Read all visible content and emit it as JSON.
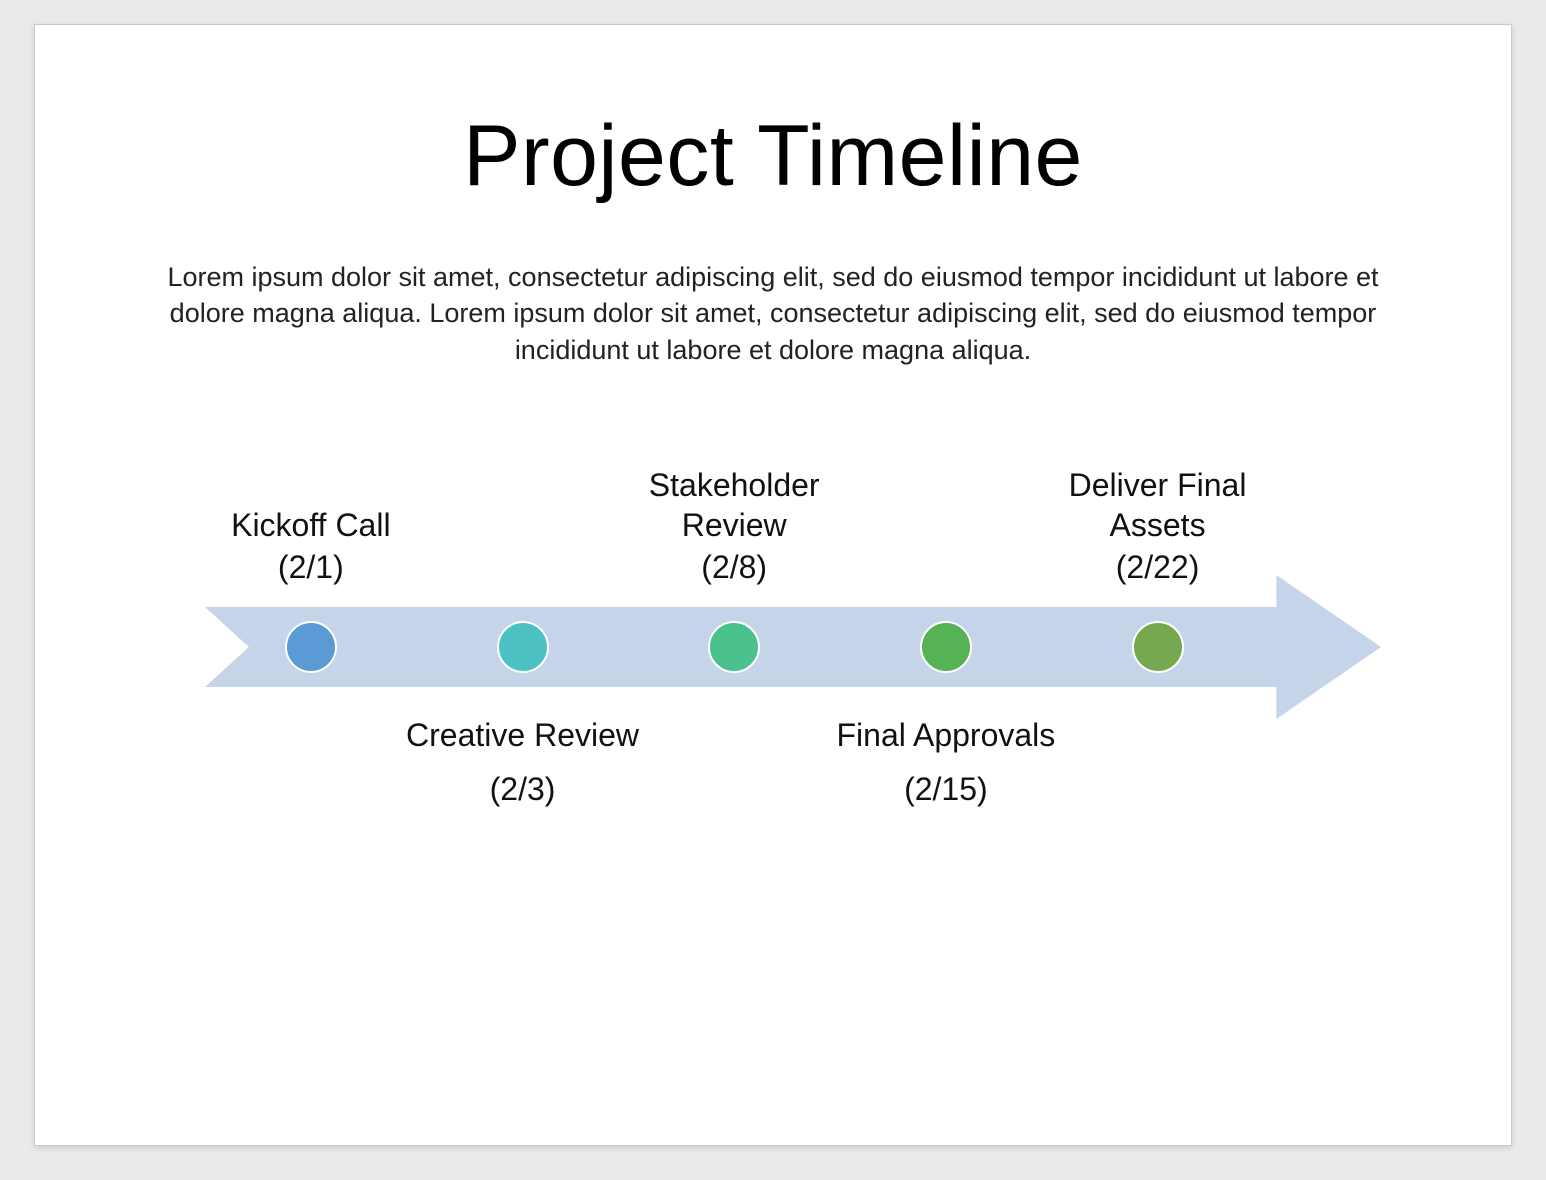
{
  "title": "Project Timeline",
  "subtitle": "Lorem ipsum dolor sit amet, consectetur adipiscing elit, sed do eiusmod tempor incididunt ut labore et dolore magna aliqua. Lorem ipsum dolor sit amet, consectetur adipiscing elit, sed do eiusmod tempor incididunt ut labore et dolore magna aliqua.",
  "arrow_color": "#c6d4ea",
  "milestones": [
    {
      "label": "Kickoff Call",
      "date": "(2/1)",
      "pos": "top",
      "color": "#5b9bd5"
    },
    {
      "label": "Creative Review",
      "date": "(2/3)",
      "pos": "bottom",
      "color": "#4bc1c4"
    },
    {
      "label": "Stakeholder Review",
      "date": "(2/8)",
      "pos": "top",
      "color": "#4bc18e"
    },
    {
      "label": "Final Approvals",
      "date": "(2/15)",
      "pos": "bottom",
      "color": "#55b356"
    },
    {
      "label": "Deliver Final Assets",
      "date": "(2/22)",
      "pos": "top",
      "color": "#76a94f"
    }
  ],
  "marker_positions_pct": [
    9,
    27,
    45,
    63,
    81
  ]
}
